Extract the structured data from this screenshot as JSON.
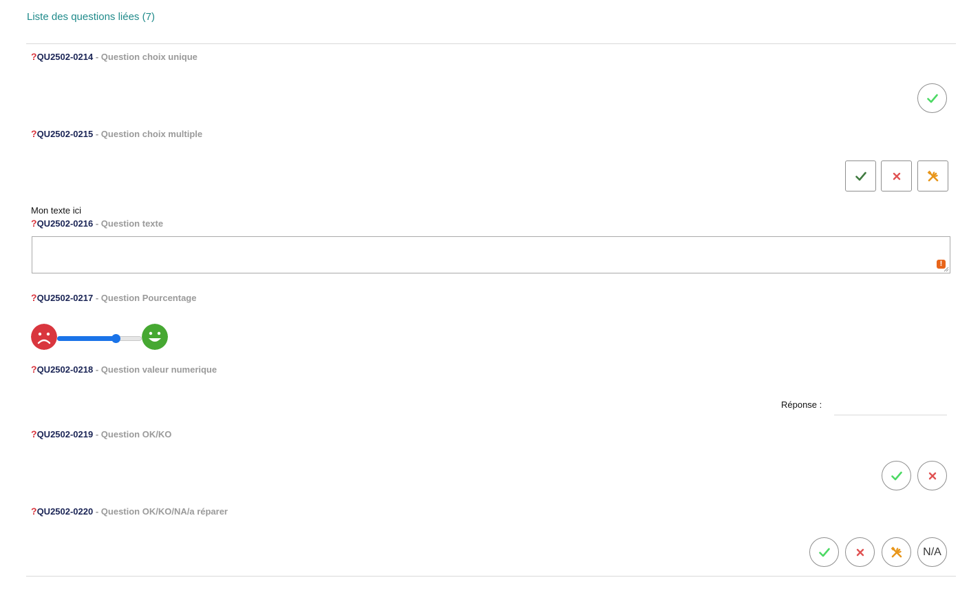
{
  "section": {
    "title": "Liste des questions liées (7)"
  },
  "questions": [
    {
      "qmark": "?",
      "code": "QU2502-0214",
      "label": " - Question choix unique"
    },
    {
      "qmark": "?",
      "code": "QU2502-0215",
      "label": " - Question choix multiple"
    },
    {
      "qmark": "?",
      "code": "QU2502-0216",
      "label": " - Question texte"
    },
    {
      "qmark": "?",
      "code": "QU2502-0217",
      "label": " - Question Pourcentage"
    },
    {
      "qmark": "?",
      "code": "QU2502-0218",
      "label": " - Question valeur numerique"
    },
    {
      "qmark": "?",
      "code": "QU2502-0219",
      "label": " - Question OK/KO"
    },
    {
      "qmark": "?",
      "code": "QU2502-0220",
      "label": " - Question OK/KO/NA/a réparer"
    }
  ],
  "text_question": {
    "intro_text": "Mon texte ici",
    "warning_icon_text": "!"
  },
  "percentage": {
    "value_fraction": 0.72
  },
  "numeric": {
    "reponse_label": "Réponse :",
    "value": ""
  },
  "okko_na": {
    "na_label": "N/A"
  },
  "colors": {
    "title": "#1f8a8a",
    "ok_green": "#4cd964",
    "ok_dark_green": "#3f7a3f",
    "ko_red": "#e05252",
    "repair_orange": "#e8961a",
    "slider_blue": "#1a73e8",
    "sad_red": "#d9363e",
    "happy_green": "#46a832"
  }
}
